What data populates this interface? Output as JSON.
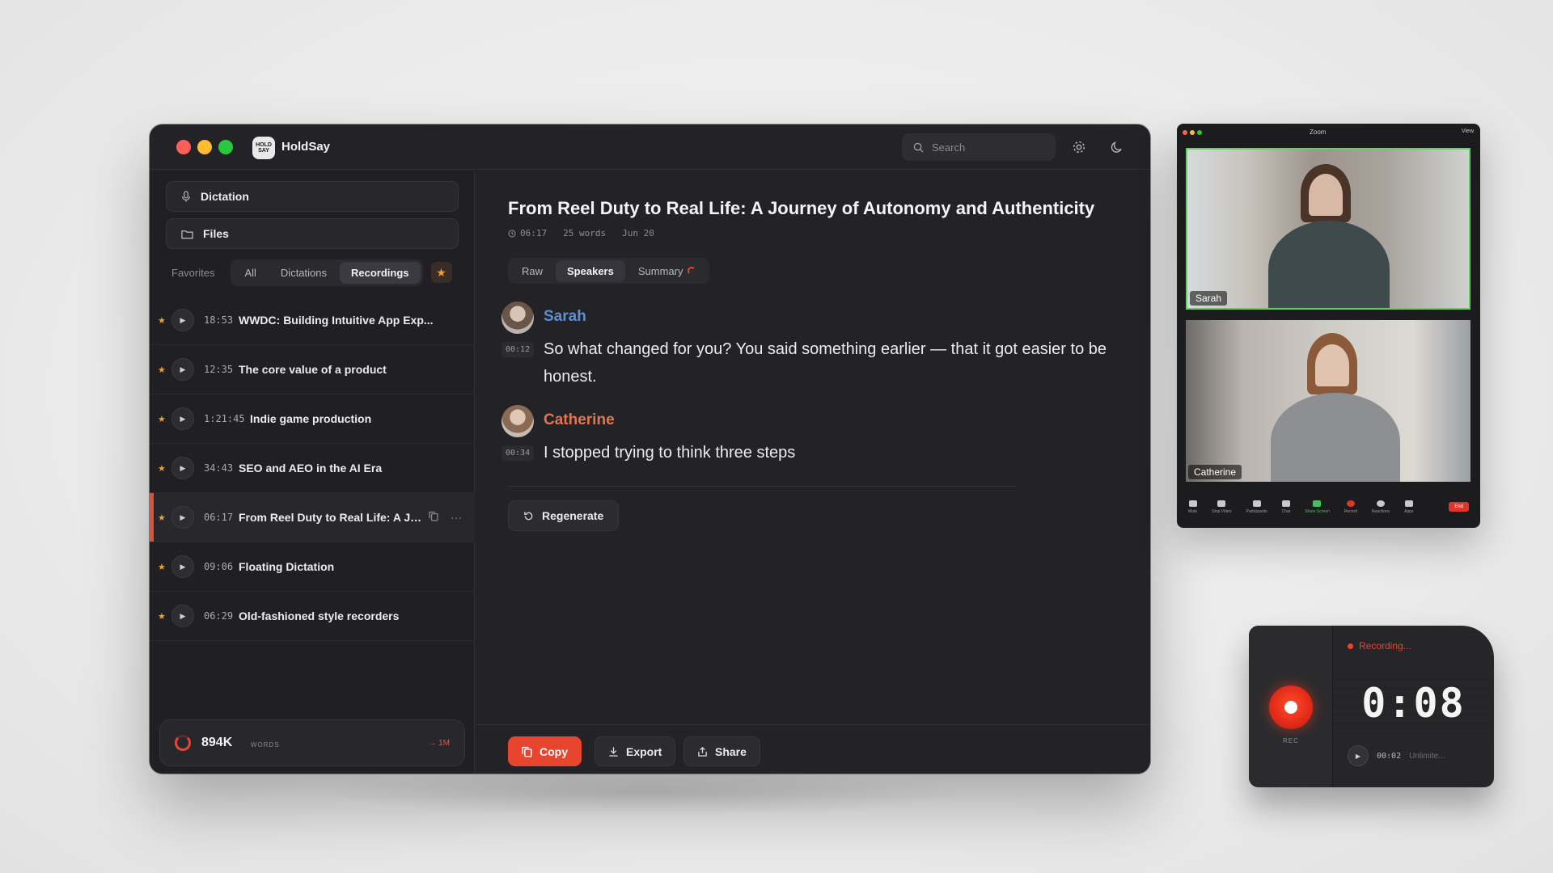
{
  "app": {
    "name": "HoldSay",
    "logo_text": "HOLD SAY",
    "search_placeholder": "Search"
  },
  "sidebar": {
    "dictation_label": "Dictation",
    "files_label": "Files",
    "favorites_label": "Favorites",
    "filters": [
      "All",
      "Dictations",
      "Recordings"
    ],
    "active_filter": "Recordings",
    "items": [
      {
        "duration": "18:53",
        "title": "WWDC: Building Intuitive App Exp...",
        "favorite": true
      },
      {
        "duration": "12:35",
        "title": "The core value of a product",
        "favorite": true
      },
      {
        "duration": "1:21:45",
        "title": "Indie game production",
        "favorite": true
      },
      {
        "duration": "34:43",
        "title": "SEO and AEO in the AI Era",
        "favorite": true
      },
      {
        "duration": "06:17",
        "title": "From Reel Duty to Real Life: A Jou...",
        "favorite": true,
        "active": true
      },
      {
        "duration": "09:06",
        "title": "Floating Dictation",
        "favorite": true
      },
      {
        "duration": "06:29",
        "title": "Old-fashioned style recorders",
        "favorite": true
      }
    ],
    "word_count": "894K",
    "word_unit": "WORDS",
    "goal": "→ 1M"
  },
  "document": {
    "title": "From Reel Duty to Real Life: A Journey of Autonomy and Authenticity",
    "duration": "06:17",
    "words": "25 words",
    "date": "Jun 20",
    "tabs": [
      "Raw",
      "Speakers",
      "Summary"
    ],
    "active_tab": "Speakers",
    "segments": [
      {
        "speaker": "Sarah",
        "time": "00:12",
        "color": "#5b8fd6",
        "text": "So what changed for you? You said something earlier — that it got easier to be honest."
      },
      {
        "speaker": "Catherine",
        "time": "00:34",
        "color": "#e0764e",
        "text": "I stopped trying to think three steps"
      }
    ],
    "regenerate_label": "Regenerate",
    "actions": {
      "copy": "Copy",
      "export": "Export",
      "share": "Share"
    }
  },
  "zoom": {
    "title": "Zoom",
    "view_label": "View",
    "participants": [
      "Sarah",
      "Catherine"
    ],
    "controls": [
      "Mute",
      "Stop Video",
      "Participants",
      "Chat",
      "Share Screen",
      "Record",
      "Reactions",
      "Apps"
    ],
    "end_label": "End"
  },
  "recorder": {
    "status": "Recording...",
    "timer": "0:08",
    "rec_label": "REC",
    "elapsed": "00:02",
    "limit": "Unlimite..."
  },
  "colors": {
    "accent": "#e8452f",
    "star": "#f0a030",
    "sarah": "#5b8fd6",
    "catherine": "#e0764e"
  }
}
